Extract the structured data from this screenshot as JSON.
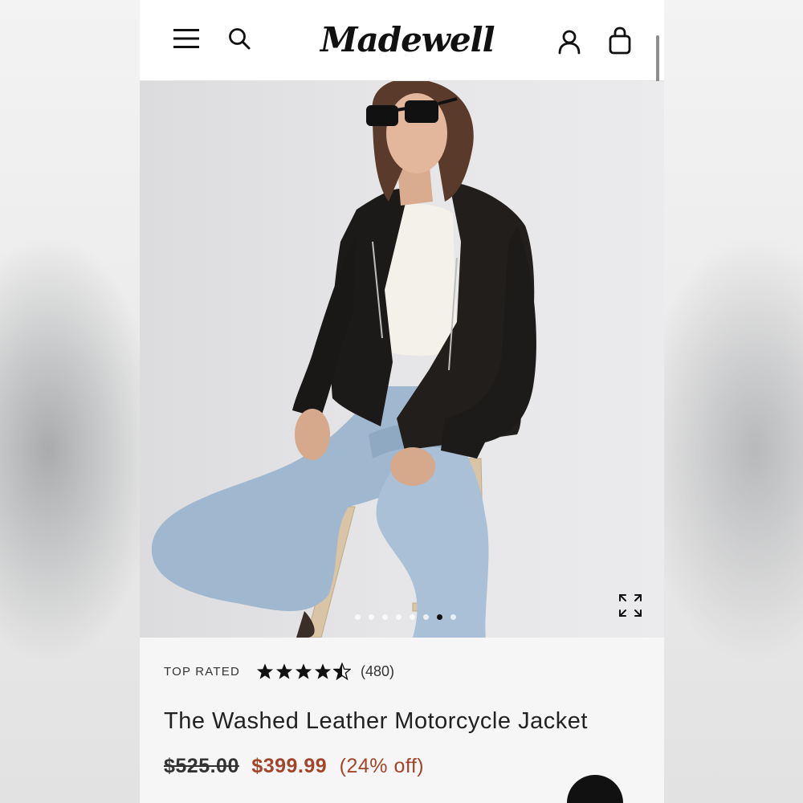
{
  "brand": {
    "logo_text": "Madewell"
  },
  "header": {
    "menu_icon": "hamburger-menu-icon",
    "search_icon": "search-icon",
    "account_icon": "user-account-icon",
    "bag_icon": "shopping-bag-icon"
  },
  "gallery": {
    "image_description_icon": "product-photo",
    "expand_icon": "expand-fullscreen-icon",
    "slide_count": 8,
    "active_slide": 6
  },
  "product": {
    "badge": "TOP RATED",
    "rating": 4.5,
    "rating_max": 5,
    "review_count": "(480)",
    "title": "The Washed Leather Motorcycle Jacket",
    "original_price": "$525.00",
    "sale_price": "$399.99",
    "discount": "(24% off)"
  },
  "colors": {
    "sale": "#a2452a",
    "text": "#222222",
    "info_bg": "#f6f6f6"
  }
}
